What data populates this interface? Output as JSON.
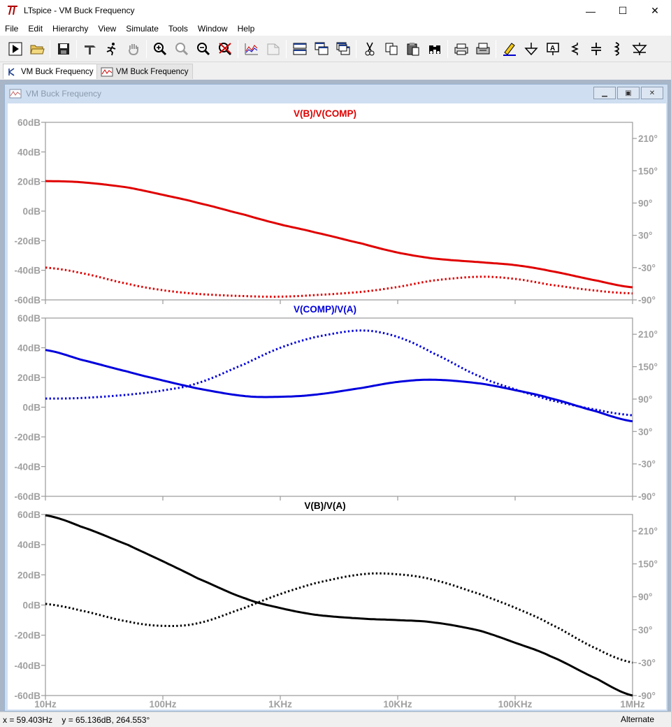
{
  "window": {
    "title": "LTspice - VM Buck Frequency",
    "controls": {
      "minimize": "—",
      "maximize": "☐",
      "close": "✕"
    }
  },
  "menu": [
    "File",
    "Edit",
    "Hierarchy",
    "View",
    "Simulate",
    "Tools",
    "Window",
    "Help"
  ],
  "toolbar": {
    "icons": [
      "run-icon",
      "open-icon",
      "save-icon",
      "control-panel-icon",
      "halt-icon",
      "pan-icon",
      "zoom-in-icon",
      "zoom-area-icon",
      "zoom-out-icon",
      "zoom-cancel-icon",
      "autorange-icon",
      "view-fft-icon",
      "tile-horizontal-icon",
      "cascade-icon",
      "tile-vertical-icon",
      "cut-icon",
      "copy-icon",
      "paste-icon",
      "find-icon",
      "print-preview-icon",
      "print-icon",
      "draw-wire-icon",
      "ground-icon",
      "label-net-icon",
      "resistor-icon",
      "capacitor-icon",
      "inductor-icon",
      "diode-icon"
    ]
  },
  "tabs": [
    {
      "label": "VM Buck Frequency",
      "icon": "schematic-icon",
      "active": true
    },
    {
      "label": "VM Buck Frequency",
      "icon": "waveform-icon",
      "active": false
    }
  ],
  "subwindow": {
    "title": "VM Buck Frequency"
  },
  "colors": {
    "pane1": "#e00000",
    "pane2": "#0000dd",
    "pane3": "#000000",
    "axis_label": "#a0a0a0",
    "mdi_bg": "#a9b6c8"
  },
  "chart_data": [
    {
      "type": "line",
      "title": "V(B)/V(COMP)",
      "x_scale": "log",
      "xlim": [
        "10Hz",
        "1MHz"
      ],
      "ylim_db": [
        -60,
        60
      ],
      "ylim_phase_deg": [
        -90,
        240
      ],
      "y_ticks_left": [
        "60dB",
        "40dB",
        "20dB",
        "0dB",
        "-20dB",
        "-40dB",
        "-60dB"
      ],
      "y_ticks_right": [
        "210°",
        "150°",
        "90°",
        "30°",
        "-30°",
        "-90°"
      ],
      "series": [
        {
          "kind": "magnitude_db",
          "style": "solid",
          "x": [
            10,
            20,
            50,
            100,
            200,
            500,
            1000,
            2000,
            5000,
            10000,
            20000,
            50000,
            100000,
            200000,
            500000,
            1000000
          ],
          "y": [
            20.3,
            19.5,
            16,
            11,
            5.5,
            -2.5,
            -9,
            -14.5,
            -22,
            -28,
            -32,
            -34.5,
            -36.5,
            -40.5,
            -47,
            -51.5
          ]
        },
        {
          "kind": "phase_deg",
          "style": "dotted",
          "x": [
            10,
            20,
            50,
            100,
            200,
            500,
            1000,
            2000,
            5000,
            10000,
            20000,
            50000,
            100000,
            200000,
            500000,
            1000000
          ],
          "y": [
            -30,
            -40,
            -60,
            -72,
            -79,
            -83,
            -84,
            -81,
            -75,
            -66,
            -54,
            -47,
            -51,
            -62,
            -73,
            -78
          ]
        }
      ]
    },
    {
      "type": "line",
      "title": "V(COMP)/V(A)",
      "x_scale": "log",
      "xlim": [
        "10Hz",
        "1MHz"
      ],
      "ylim_db": [
        -60,
        60
      ],
      "ylim_phase_deg": [
        -90,
        240
      ],
      "y_ticks_left": [
        "60dB",
        "40dB",
        "20dB",
        "0dB",
        "-20dB",
        "-40dB",
        "-60dB"
      ],
      "y_ticks_right": [
        "210°",
        "150°",
        "90°",
        "30°",
        "-30°",
        "-90°"
      ],
      "series": [
        {
          "kind": "magnitude_db",
          "style": "solid",
          "x": [
            10,
            20,
            50,
            100,
            200,
            500,
            1000,
            2000,
            5000,
            10000,
            20000,
            50000,
            100000,
            200000,
            500000,
            1000000
          ],
          "y": [
            38.5,
            32,
            24,
            18,
            12.5,
            7.5,
            7,
            8.5,
            13,
            17,
            18.5,
            16,
            11.5,
            6,
            -3,
            -9.5
          ]
        },
        {
          "kind": "phase_deg",
          "style": "dotted",
          "x": [
            10,
            20,
            50,
            100,
            200,
            500,
            1000,
            2000,
            5000,
            10000,
            20000,
            50000,
            100000,
            200000,
            500000,
            1000000
          ],
          "y": [
            91,
            92,
            98,
            106,
            120,
            155,
            185,
            205,
            217,
            205,
            175,
            132,
            108,
            88,
            70,
            60
          ]
        }
      ]
    },
    {
      "type": "line",
      "title": "V(B)/V(A)",
      "x_scale": "log",
      "xlim": [
        "10Hz",
        "1MHz"
      ],
      "ylim_db": [
        -60,
        60
      ],
      "ylim_phase_deg": [
        -90,
        240
      ],
      "x_ticks": [
        "10Hz",
        "100Hz",
        "1KHz",
        "10KHz",
        "100KHz",
        "1MHz"
      ],
      "y_ticks_left": [
        "60dB",
        "40dB",
        "20dB",
        "0dB",
        "-20dB",
        "-40dB",
        "-60dB"
      ],
      "y_ticks_right": [
        "210°",
        "150°",
        "90°",
        "30°",
        "-30°",
        "-90°"
      ],
      "series": [
        {
          "kind": "magnitude_db",
          "style": "solid",
          "x": [
            10,
            20,
            50,
            100,
            200,
            500,
            1000,
            2000,
            5000,
            10000,
            20000,
            50000,
            100000,
            200000,
            500000,
            1000000
          ],
          "y": [
            59.5,
            52,
            40,
            29,
            17.5,
            4.5,
            -2,
            -6.5,
            -9,
            -10,
            -11.5,
            -17,
            -25,
            -34,
            -49,
            -60
          ]
        },
        {
          "kind": "phase_deg",
          "style": "dotted",
          "x": [
            10,
            20,
            50,
            100,
            200,
            500,
            1000,
            2000,
            5000,
            10000,
            20000,
            50000,
            100000,
            200000,
            500000,
            1000000
          ],
          "y": [
            77,
            65,
            45,
            37,
            42,
            70,
            95,
            115,
            131,
            131,
            121,
            95,
            70,
            40,
            -5,
            -30
          ]
        }
      ]
    }
  ],
  "status": {
    "cursor": "x = 59.403Hz    y = 65.136dB, 264.553°",
    "mode": "Alternate"
  }
}
